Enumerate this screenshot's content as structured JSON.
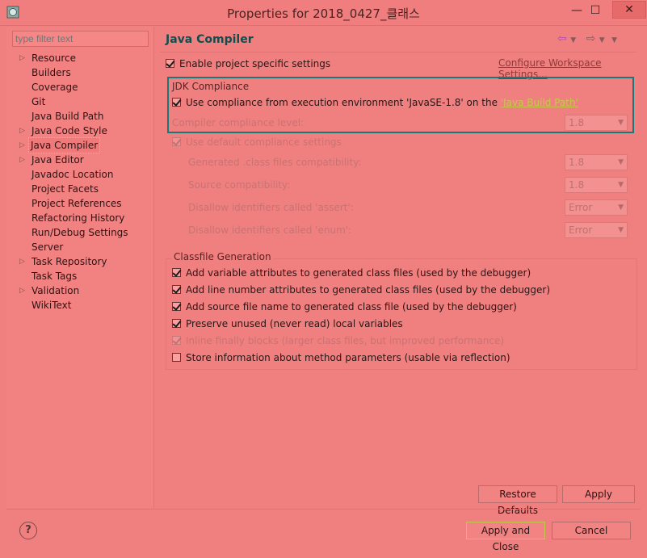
{
  "window": {
    "title": "Properties for 2018_0427_클래스",
    "minimize": "—",
    "maximize": "☐",
    "close": "✕"
  },
  "sidebar": {
    "filter_placeholder": "type filter text",
    "items": [
      {
        "label": "Resource",
        "has_children": true
      },
      {
        "label": "Builders",
        "has_children": false
      },
      {
        "label": "Coverage",
        "has_children": false
      },
      {
        "label": "Git",
        "has_children": false
      },
      {
        "label": "Java Build Path",
        "has_children": false
      },
      {
        "label": "Java Code Style",
        "has_children": true
      },
      {
        "label": "Java Compiler",
        "has_children": true,
        "selected": true
      },
      {
        "label": "Java Editor",
        "has_children": true
      },
      {
        "label": "Javadoc Location",
        "has_children": false
      },
      {
        "label": "Project Facets",
        "has_children": false
      },
      {
        "label": "Project References",
        "has_children": false
      },
      {
        "label": "Refactoring History",
        "has_children": false
      },
      {
        "label": "Run/Debug Settings",
        "has_children": false
      },
      {
        "label": "Server",
        "has_children": false
      },
      {
        "label": "Task Repository",
        "has_children": true
      },
      {
        "label": "Task Tags",
        "has_children": false
      },
      {
        "label": "Validation",
        "has_children": true
      },
      {
        "label": "WikiText",
        "has_children": false
      }
    ]
  },
  "panel": {
    "title": "Java Compiler",
    "enable_project_settings": "Enable project specific settings",
    "configure_workspace_link": "Configure Workspace Settings...",
    "jdk": {
      "caption": "JDK Compliance",
      "use_compliance_prefix": "Use compliance from execution environment 'JavaSE-1.8' on the ",
      "java_build_path_link": "'Java Build Path'",
      "compiler_compliance_label": "Compiler compliance level:",
      "compiler_compliance_value": "1.8"
    },
    "use_default_compliance": "Use default compliance settings",
    "generated_label": "Generated .class files compatibility:",
    "generated_value": "1.8",
    "source_label": "Source compatibility:",
    "source_value": "1.8",
    "assert_label": "Disallow identifiers called 'assert':",
    "assert_value": "Error",
    "enum_label": "Disallow identifiers called 'enum':",
    "enum_value": "Error",
    "classfile": {
      "caption": "Classfile Generation",
      "options": [
        {
          "label": "Add variable attributes to generated class files (used by the debugger)",
          "checked": true,
          "enabled": true
        },
        {
          "label": "Add line number attributes to generated class files (used by the debugger)",
          "checked": true,
          "enabled": true
        },
        {
          "label": "Add source file name to generated class file (used by the debugger)",
          "checked": true,
          "enabled": true
        },
        {
          "label": "Preserve unused (never read) local variables",
          "checked": true,
          "enabled": true
        },
        {
          "label": "Inline finally blocks (larger class files, but improved performance)",
          "checked": true,
          "enabled": false
        },
        {
          "label": "Store information about method parameters (usable via reflection)",
          "checked": false,
          "enabled": true
        }
      ]
    },
    "restore_defaults": "Restore Defaults",
    "apply": "Apply"
  },
  "footer": {
    "help": "?",
    "apply_and_close": "Apply and Close",
    "cancel": "Cancel"
  }
}
